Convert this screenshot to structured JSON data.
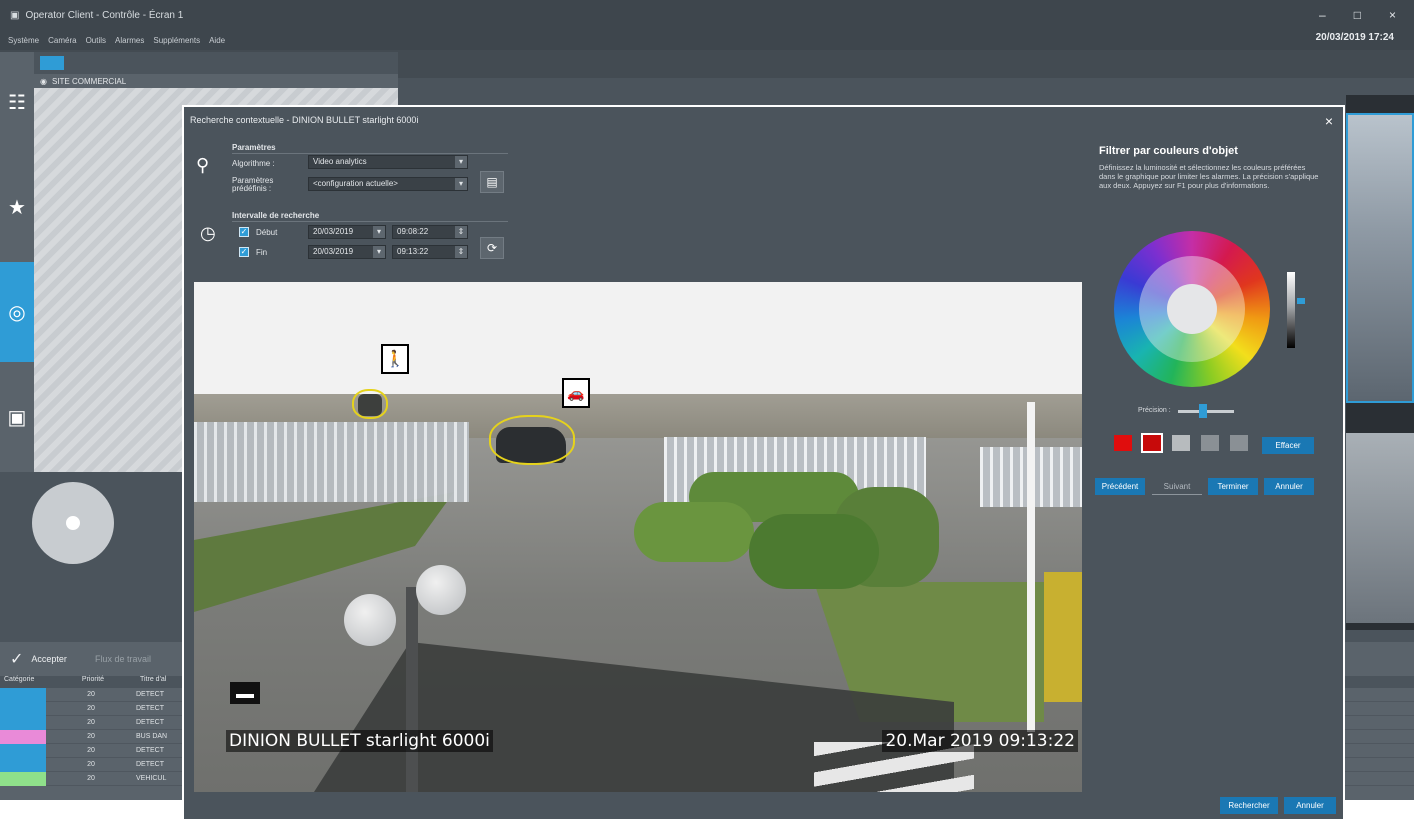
{
  "app": {
    "title": "Operator Client - Contrôle - Écran 1",
    "menu": [
      "Système",
      "Caméra",
      "Outils",
      "Alarmes",
      "Suppléments",
      "Aide"
    ],
    "datetime": "20/03/2019 17:24",
    "win_controls": [
      "–",
      "□",
      "×"
    ]
  },
  "tree": {
    "site": "SITE COMMERCIAL"
  },
  "alarms": {
    "accept_label": "Accepter",
    "workflow_label": "Flux de travail",
    "columns": [
      "Catégorie",
      "Priorité",
      "Titre d'al"
    ],
    "rows": [
      {
        "priority": "20",
        "title": "DETECT",
        "color": "#2f9cd6"
      },
      {
        "priority": "20",
        "title": "DETECT",
        "color": "#2f9cd6"
      },
      {
        "priority": "20",
        "title": "DETECT",
        "color": "#2f9cd6"
      },
      {
        "priority": "20",
        "title": "BUS DAN",
        "color": "#e98ad8"
      },
      {
        "priority": "20",
        "title": "DETECT",
        "color": "#2f9cd6"
      },
      {
        "priority": "20",
        "title": "DETECT",
        "color": "#2f9cd6"
      },
      {
        "priority": "20",
        "title": "VEHICUL",
        "color": "#8fe08a"
      }
    ]
  },
  "dialog": {
    "title": "Recherche contextuelle - DINION BULLET starlight 6000i",
    "close": "×",
    "params_heading": "Paramètres",
    "algo_label": "Algorithme :",
    "algo_value": "Video analytics",
    "preset_label": "Paramètres prédéfinis :",
    "preset_value": "<configuration actuelle>",
    "interval_heading": "Intervalle de recherche",
    "start_label": "Début",
    "start_date": "20/03/2019",
    "start_time": "09:08:22",
    "end_label": "Fin",
    "end_date": "20/03/2019",
    "end_time": "09:13:22",
    "video_camera": "DINION BULLET starlight 6000i",
    "video_timestamp": "20.Mar 2019   09:13:22",
    "filter_title": "Filtrer par couleurs d'objet",
    "filter_desc": "Définissez la luminosité et sélectionnez les couleurs préférées dans le graphique pour limiter les alarmes. La précision s'applique aux deux. Appuyez sur F1 pour plus d'informations.",
    "precision_label": "Précision :",
    "precision_value": 0.45,
    "luminance_value": 0.35,
    "clear_label": "Effacer",
    "prev_label": "Précédent",
    "next_label": "Suivant",
    "finish_label": "Terminer",
    "cancel_nav_label": "Annuler",
    "search_label": "Rechercher",
    "cancel_label": "Annuler",
    "swatches": [
      "#e00d0d",
      "#c70a0a",
      "#b7bbbe",
      "#8a9095",
      "#8a9095"
    ]
  }
}
